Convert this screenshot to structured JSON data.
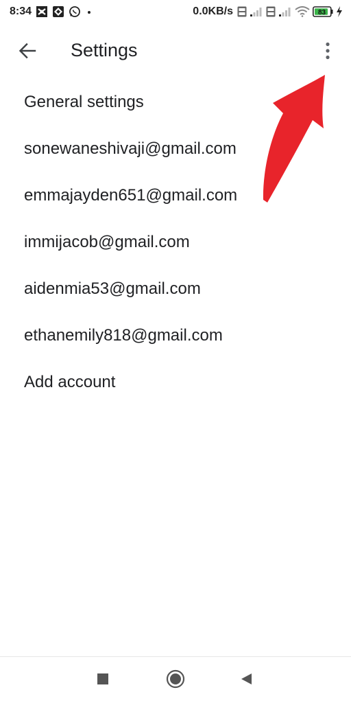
{
  "status_bar": {
    "time": "8:34",
    "net_speed": "0.0KB/s",
    "battery": "83",
    "icons": [
      "app-notification-icon",
      "photos-icon",
      "whatsapp-icon",
      "dot-icon",
      "volte-icon",
      "signal-icon",
      "volte-icon",
      "signal-icon",
      "wifi-icon",
      "battery-icon",
      "charging-icon"
    ]
  },
  "app_bar": {
    "title": "Settings",
    "back_icon": "arrow-back-icon",
    "more_icon": "more-vert-icon"
  },
  "settings": {
    "items": [
      {
        "label": "General settings"
      },
      {
        "label": "sonewaneshivaji@gmail.com"
      },
      {
        "label": "emmajayden651@gmail.com"
      },
      {
        "label": "immijacob@gmail.com"
      },
      {
        "label": "aidenmia53@gmail.com"
      },
      {
        "label": "ethanemily818@gmail.com"
      },
      {
        "label": "Add account"
      }
    ]
  },
  "annotation": {
    "color": "#e8242b",
    "icon": "red-arrow-icon"
  },
  "nav_bar": {
    "icons": [
      "recents-square-icon",
      "home-circle-icon",
      "back-triangle-icon"
    ]
  }
}
